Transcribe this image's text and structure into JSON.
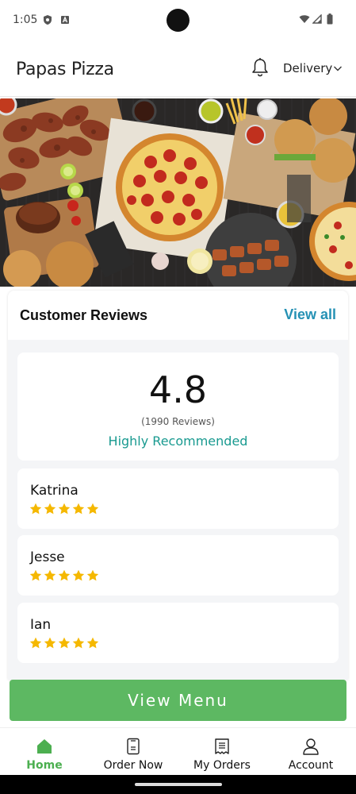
{
  "status_bar": {
    "time": "1:05"
  },
  "header": {
    "title": "Papas Pizza",
    "delivery_label": "Delivery"
  },
  "reviews": {
    "title": "Customer Reviews",
    "view_all": "View all",
    "rating": "4.8",
    "count": "(1990 Reviews)",
    "recommendation": "Highly Recommended",
    "items": [
      {
        "name": "Katrina",
        "stars": 5
      },
      {
        "name": "Jesse",
        "stars": 5
      },
      {
        "name": "Ian",
        "stars": 5
      }
    ]
  },
  "view_menu_label": "View Menu",
  "nav": [
    {
      "label": "Home",
      "icon": "home-icon",
      "active": true
    },
    {
      "label": "Order Now",
      "icon": "order-icon",
      "active": false
    },
    {
      "label": "My Orders",
      "icon": "receipt-icon",
      "active": false
    },
    {
      "label": "Account",
      "icon": "account-icon",
      "active": false
    }
  ],
  "colors": {
    "accent_teal": "#199a90",
    "link_blue": "#2591b4",
    "button_green": "#5db862",
    "nav_active": "#4caf50",
    "star": "#f5b800"
  }
}
